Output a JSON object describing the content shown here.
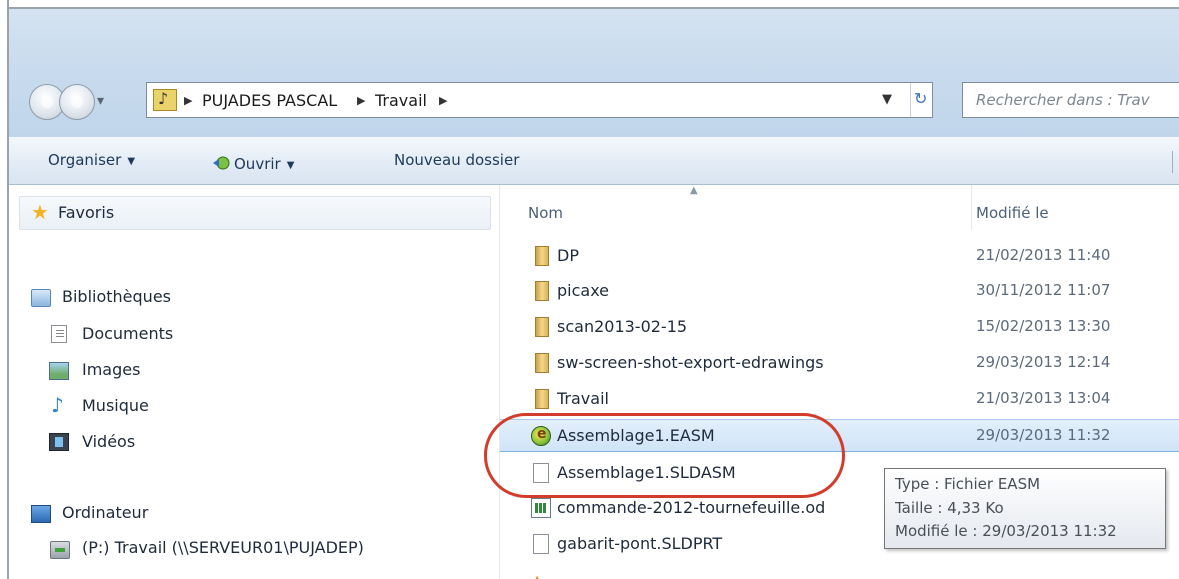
{
  "address": {
    "crumbs": [
      "PUJADES PASCAL",
      "Travail"
    ]
  },
  "search": {
    "placeholder": "Rechercher dans : Trav"
  },
  "toolbar": {
    "organize_label": "Organiser",
    "open_label": "Ouvrir",
    "new_folder_label": "Nouveau dossier"
  },
  "nav": {
    "favorites": "Favoris",
    "libraries": "Bibliothèques",
    "library_items": [
      "Documents",
      "Images",
      "Musique",
      "Vidéos"
    ],
    "computer": "Ordinateur",
    "drive": "(P:) Travail (\\\\SERVEUR01\\PUJADEP)"
  },
  "columns": {
    "name": "Nom",
    "modified": "Modifié le"
  },
  "files": [
    {
      "name": "DP",
      "date": "21/02/2013 11:40",
      "icon": "folder-icon"
    },
    {
      "name": "picaxe",
      "date": "30/11/2012 11:07",
      "icon": "folder-icon"
    },
    {
      "name": "scan2013-02-15",
      "date": "15/02/2013 13:30",
      "icon": "folder-icon"
    },
    {
      "name": "sw-screen-shot-export-edrawings",
      "date": "29/03/2013 12:14",
      "icon": "folder-icon"
    },
    {
      "name": "Travail",
      "date": "21/03/2013 13:04",
      "icon": "folder-icon"
    },
    {
      "name": "Assemblage1.EASM",
      "date": "29/03/2013 11:32",
      "icon": "edrawings-file-icon",
      "selected": true
    },
    {
      "name": "Assemblage1.SLDASM",
      "date": "",
      "icon": "file-icon"
    },
    {
      "name": "commande-2012-tournefeuille.od",
      "date": "",
      "icon": "spreadsheet-file-icon"
    },
    {
      "name": "gabarit-pont.SLDPRT",
      "date": "",
      "icon": "file-icon"
    },
    {
      "name": "",
      "date": "",
      "icon": "warning-file-icon"
    }
  ],
  "tooltip": {
    "type": "Type : Fichier EASM",
    "size": "Taille : 4,33 Ko",
    "modified": "Modifié le : 29/03/2013 11:32"
  },
  "colors": {
    "highlight": "#d33c2a",
    "selection": "#d0e4f8"
  }
}
